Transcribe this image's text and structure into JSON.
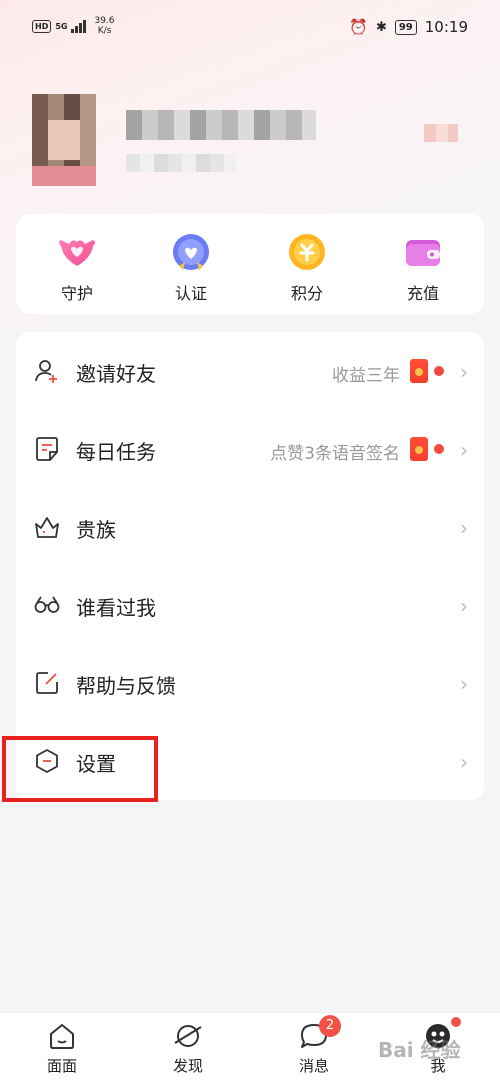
{
  "status_bar": {
    "network_badge": "HD",
    "signal_label": "5G",
    "speed_value": "39.6",
    "speed_unit": "K/s",
    "battery": "99",
    "time": "10:19"
  },
  "quick_actions": [
    {
      "label": "守护",
      "icon": "heart-icon"
    },
    {
      "label": "认证",
      "icon": "badge-heart-icon"
    },
    {
      "label": "积分",
      "icon": "coin-icon"
    },
    {
      "label": "充值",
      "icon": "wallet-icon"
    }
  ],
  "menu": [
    {
      "label": "邀请好友",
      "extra": "收益三年",
      "icon": "add-user-icon"
    },
    {
      "label": "每日任务",
      "extra": "点赞3条语音签名",
      "icon": "task-icon"
    },
    {
      "label": "贵族",
      "extra": "",
      "icon": "crown-icon"
    },
    {
      "label": "谁看过我",
      "extra": "",
      "icon": "glasses-icon"
    },
    {
      "label": "帮助与反馈",
      "extra": "",
      "icon": "feedback-icon"
    },
    {
      "label": "设置",
      "extra": "",
      "icon": "settings-icon"
    }
  ],
  "bottom_nav": [
    {
      "label": "面面",
      "icon": "home-icon"
    },
    {
      "label": "发现",
      "icon": "planet-icon"
    },
    {
      "label": "消息",
      "icon": "message-icon",
      "badge": "2"
    },
    {
      "label": "我",
      "icon": "profile-icon"
    }
  ],
  "watermark": "Bai 经验",
  "colors": {
    "accent_red": "#f04b3e",
    "highlight_border": "#e8221c",
    "background": "#f5f5f7"
  }
}
